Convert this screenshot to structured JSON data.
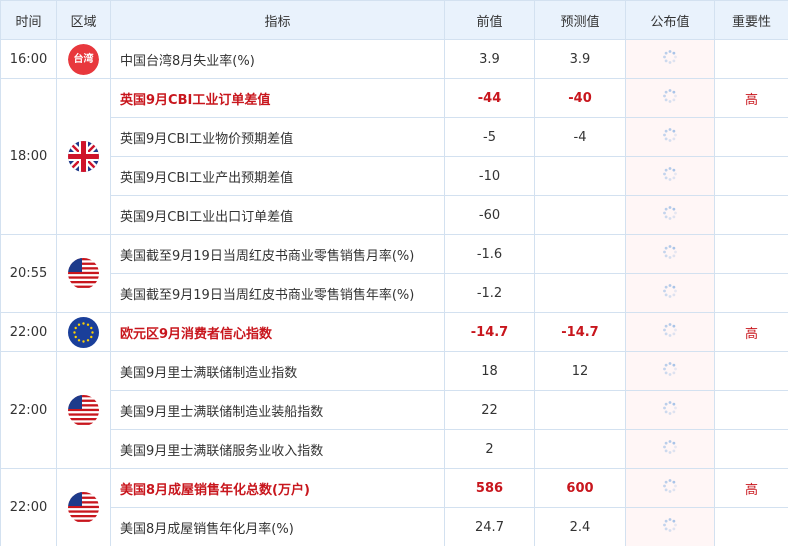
{
  "header": {
    "time": "时间",
    "region": "区域",
    "indicator": "指标",
    "previous": "前值",
    "forecast": "预测值",
    "actual": "公布值",
    "importance": "重要性"
  },
  "groups": [
    {
      "time": "16:00",
      "flag": "tw",
      "flag_label": "台湾",
      "rows": [
        {
          "name": "中国台湾8月失业率(%)",
          "prev": "3.9",
          "forecast": "3.9",
          "importance": "",
          "high": false
        }
      ]
    },
    {
      "time": "18:00",
      "flag": "uk",
      "flag_label": "",
      "rows": [
        {
          "name": "英国9月CBI工业订单差值",
          "prev": "-44",
          "forecast": "-40",
          "importance": "高",
          "high": true
        },
        {
          "name": "英国9月CBI工业物价预期差值",
          "prev": "-5",
          "forecast": "-4",
          "importance": "",
          "high": false
        },
        {
          "name": "英国9月CBI工业产出预期差值",
          "prev": "-10",
          "forecast": "",
          "importance": "",
          "high": false
        },
        {
          "name": "英国9月CBI工业出口订单差值",
          "prev": "-60",
          "forecast": "",
          "importance": "",
          "high": false
        }
      ]
    },
    {
      "time": "20:55",
      "flag": "us",
      "flag_label": "",
      "rows": [
        {
          "name": "美国截至9月19日当周红皮书商业零售销售月率(%)",
          "prev": "-1.6",
          "forecast": "",
          "importance": "",
          "high": false
        },
        {
          "name": "美国截至9月19日当周红皮书商业零售销售年率(%)",
          "prev": "-1.2",
          "forecast": "",
          "importance": "",
          "high": false
        }
      ]
    },
    {
      "time": "22:00",
      "flag": "eu",
      "flag_label": "",
      "rows": [
        {
          "name": "欧元区9月消费者信心指数",
          "prev": "-14.7",
          "forecast": "-14.7",
          "importance": "高",
          "high": true
        }
      ]
    },
    {
      "time": "22:00",
      "flag": "us",
      "flag_label": "",
      "rows": [
        {
          "name": "美国9月里士满联储制造业指数",
          "prev": "18",
          "forecast": "12",
          "importance": "",
          "high": false
        },
        {
          "name": "美国9月里士满联储制造业装船指数",
          "prev": "22",
          "forecast": "",
          "importance": "",
          "high": false
        },
        {
          "name": "美国9月里士满联储服务业收入指数",
          "prev": "2",
          "forecast": "",
          "importance": "",
          "high": false
        }
      ]
    },
    {
      "time": "22:00",
      "flag": "us",
      "flag_label": "",
      "rows": [
        {
          "name": "美国8月成屋销售年化总数(万户)",
          "prev": "586",
          "forecast": "600",
          "importance": "高",
          "high": true
        },
        {
          "name": "美国8月成屋销售年化月率(%)",
          "prev": "24.7",
          "forecast": "2.4",
          "importance": "",
          "high": false
        }
      ]
    }
  ],
  "colors": {
    "header_bg": "#e9f2fc",
    "border": "#d3e1f0",
    "highlight": "#c8161d",
    "actual_bg": "#fff6f6"
  },
  "icons": {
    "loading": "loading-spinner-icon"
  }
}
